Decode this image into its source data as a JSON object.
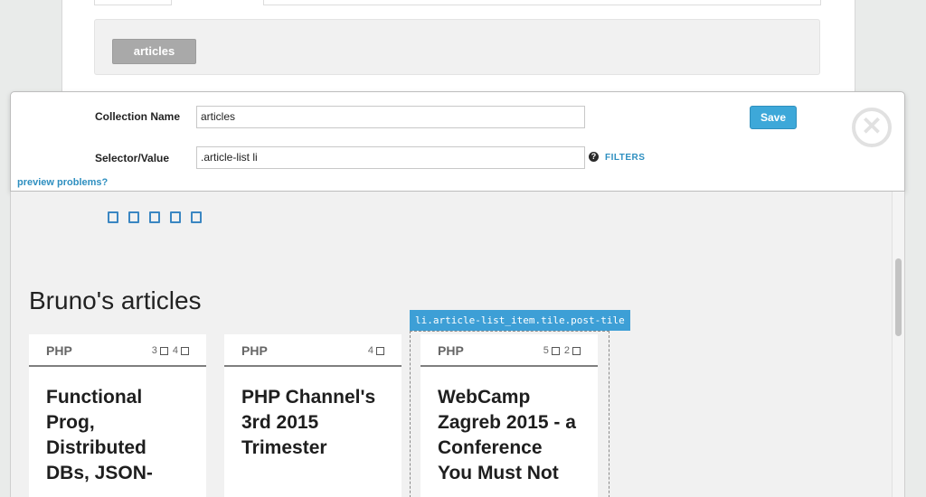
{
  "background": {
    "tag_label": "articles"
  },
  "editor": {
    "collection_name_label": "Collection Name",
    "collection_name_value": "articles",
    "selector_label": "Selector/Value",
    "selector_value": ".article-list li",
    "filters_link": "FILTERS",
    "preview_link": "preview problems?",
    "save_label": "Save",
    "close_glyph": "✕",
    "help_glyph": "?"
  },
  "preview": {
    "heading": "Bruno's articles",
    "selector_badge": "li.article-list_item.tile.post-tile",
    "tiles": [
      {
        "category": "PHP",
        "stat1": "3",
        "stat2": "4",
        "title": "Functional Prog, Distributed DBs, JSON-"
      },
      {
        "category": "PHP",
        "stat1": "4",
        "stat2": "",
        "title": "PHP Channel's 3rd 2015 Trimester"
      },
      {
        "category": "PHP",
        "stat1": "5",
        "stat2": "2",
        "title": "WebCamp Zagreb 2015 - a Conference You Must Not"
      }
    ]
  },
  "colors": {
    "accent": "#3da8d9",
    "link": "#2e8fc0",
    "selector_badge": "#3d9fd6"
  }
}
